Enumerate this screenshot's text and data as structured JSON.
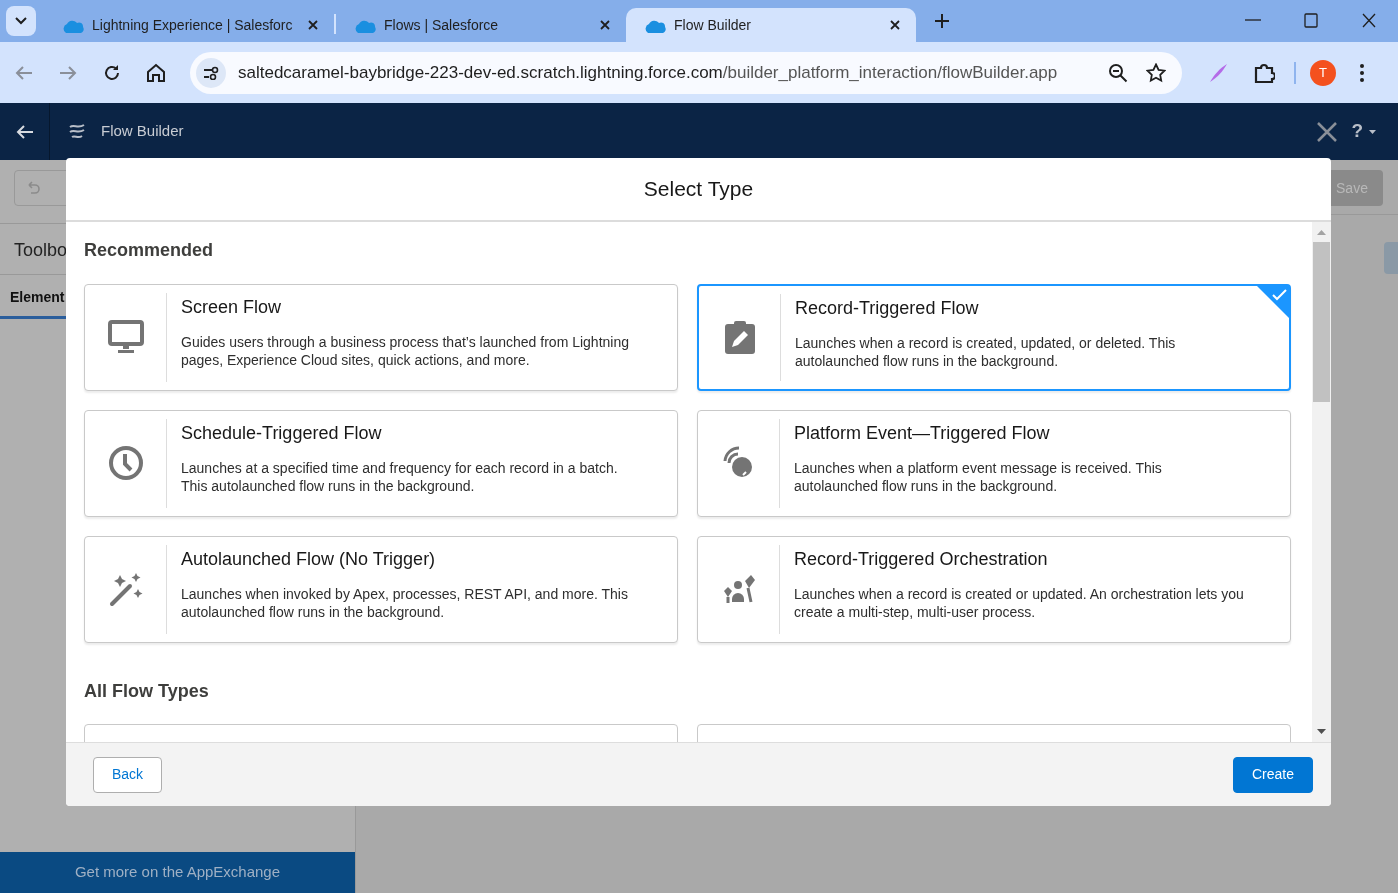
{
  "browser": {
    "tabs": [
      {
        "title": "Lightning Experience | Salesforc",
        "selected": false
      },
      {
        "title": "Flows | Salesforce",
        "selected": false
      },
      {
        "title": "Flow Builder",
        "selected": true
      }
    ],
    "url": {
      "host": "saltedcaramel-baybridge-223-dev-ed.scratch.lightning.force.com",
      "path": "/builder_platform_interaction/flowBuilder.app"
    },
    "profile_initial": "T"
  },
  "app_header": {
    "title": "Flow Builder",
    "help": "?"
  },
  "background": {
    "toolbox_title": "Toolbo",
    "tab": "Element",
    "save": "Save",
    "footer_link": "Get more on the AppExchange"
  },
  "modal": {
    "title": "Select Type",
    "sections": [
      {
        "heading": "Recommended",
        "kind": "grid",
        "cards": [
          {
            "title": "Screen Flow",
            "description": "Guides users through a business process that’s launched from Lightning pages, Experience Cloud sites, quick actions, and more.",
            "kind": "monitor",
            "selected": false
          },
          {
            "title": "Record-Triggered Flow",
            "description": "Launches when a record is created, updated, or deleted. This autolaunched flow runs in the background.",
            "kind": "clipboard",
            "selected": true
          },
          {
            "title": "Schedule-Triggered Flow",
            "description": "Launches at a specified time and frequency for each record in a batch. This autolaunched flow runs in the background.",
            "kind": "clock",
            "selected": false
          },
          {
            "title": "Platform Event—Triggered Flow",
            "description": "Launches when a platform event message is received. This autolaunched flow runs in the background.",
            "kind": "signal",
            "selected": false
          },
          {
            "title": "Autolaunched Flow (No Trigger)",
            "description": "Launches when invoked by Apex, processes, REST API, and more. This autolaunched flow runs in the background.",
            "kind": "wand",
            "selected": false
          },
          {
            "title": "Record-Triggered Orchestration",
            "description": "Launches when a record is created or updated. An orchestration lets you create a multi-step, multi-user process.",
            "kind": "people",
            "selected": false
          }
        ]
      },
      {
        "heading": "All Flow Types",
        "kind": "cut_off"
      }
    ],
    "buttons": [
      {
        "label": "Back",
        "kind": "neutral"
      },
      {
        "label": "Create",
        "kind": "brand"
      }
    ]
  }
}
